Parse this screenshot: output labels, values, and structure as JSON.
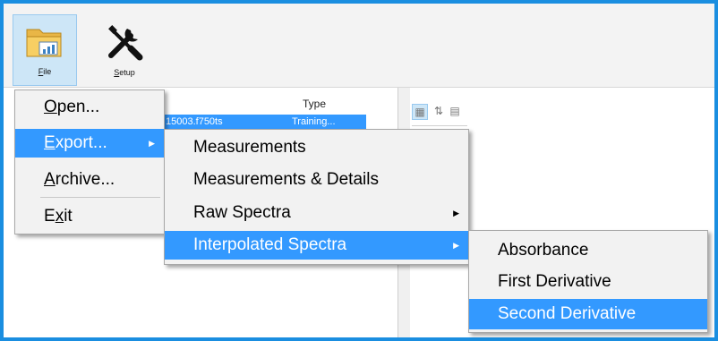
{
  "ribbon": {
    "file_label_underlined": "F",
    "file_label_rest": "ile",
    "setup_label_underlined": "S",
    "setup_label_rest": "etup"
  },
  "list": {
    "header_type": "Type",
    "selected_name": "15003.f750ts",
    "selected_type": "Training..."
  },
  "file_menu": {
    "items": [
      {
        "pre": "",
        "u": "O",
        "post": "pen..."
      },
      {
        "pre": "",
        "u": "E",
        "post": "xport..."
      },
      {
        "pre": "",
        "u": "A",
        "post": "rchive..."
      },
      {
        "pre": "E",
        "u": "x",
        "post": "it"
      }
    ],
    "highlighted": "Export..."
  },
  "export_menu": {
    "items": [
      "Measurements",
      "Measurements & Details",
      "Raw Spectra",
      "Interpolated Spectra"
    ],
    "highlighted": "Interpolated Spectra"
  },
  "spectra_menu": {
    "items": [
      "Absorbance",
      "First Derivative",
      "Second Derivative"
    ],
    "highlighted": "Second Derivative"
  },
  "colors": {
    "accent": "#3399ff",
    "frame": "#1a8ee0"
  }
}
